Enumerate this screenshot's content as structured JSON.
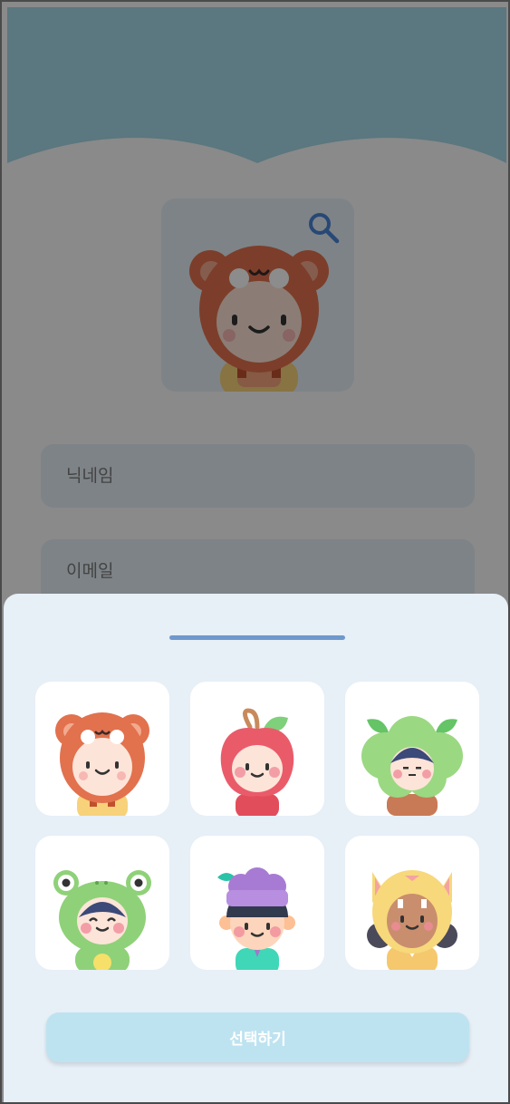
{
  "profile": {
    "avatar_icon": "bear-costume-avatar-icon",
    "search_icon": "magnifier-icon"
  },
  "form": {
    "nickname_placeholder": "닉네임",
    "email_placeholder": "이메일"
  },
  "sheet": {
    "avatars": [
      {
        "id": "bear",
        "icon": "bear-costume-avatar-icon"
      },
      {
        "id": "apple",
        "icon": "apple-costume-avatar-icon"
      },
      {
        "id": "broccoli",
        "icon": "broccoli-costume-avatar-icon"
      },
      {
        "id": "frog",
        "icon": "frog-costume-avatar-icon"
      },
      {
        "id": "grape",
        "icon": "grape-hat-avatar-icon"
      },
      {
        "id": "cat",
        "icon": "cat-costume-avatar-icon"
      }
    ],
    "select_label": "선택하기"
  },
  "colors": {
    "header": "#a7d9e8",
    "sheet_bg": "#e7eff7",
    "handle": "#6f98cc",
    "button": "#bee3f0"
  }
}
